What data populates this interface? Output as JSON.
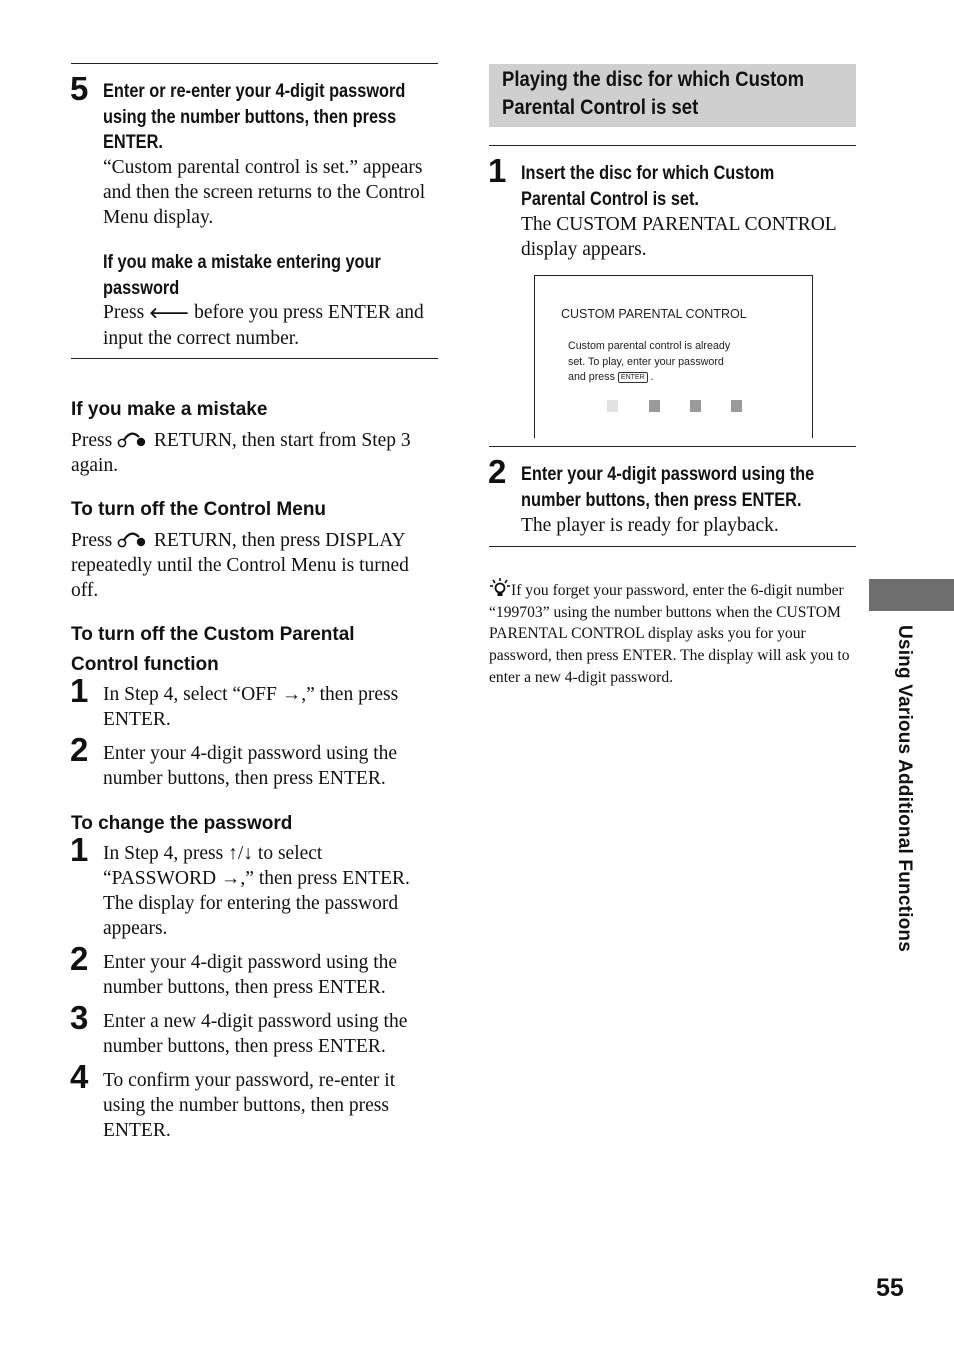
{
  "left_column": {
    "step5": {
      "number": "5",
      "heading_lines": [
        "Enter or re-enter your 4-digit password",
        "using the number buttons, then press",
        "ENTER."
      ],
      "body_lines": [
        "“Custom parental control is set.” appears",
        "and then the screen returns to the Control",
        "Menu display."
      ],
      "sub_heading_lines": [
        "If you make a mistake entering your",
        "password"
      ],
      "sub_body_prefix": "Press ",
      "sub_body_icon": "left-arrow-icon",
      "sub_body_line1_suffix": " before you press ENTER and",
      "sub_body_line2": "input the correct number."
    },
    "mistake": {
      "heading": "If you make a mistake",
      "line1_prefix": "Press ",
      "line1_suffix": " RETURN, then start from Step 3",
      "line2": "again."
    },
    "turn_off_menu": {
      "heading": "To turn off the Control Menu",
      "line1_prefix": "Press ",
      "line1_suffix": " RETURN, then press DISPLAY",
      "line2": "repeatedly until the Control Menu is turned",
      "line3": "off."
    },
    "turn_off_custom": {
      "heading_lines": [
        "To turn off the Custom Parental",
        "Control function"
      ],
      "steps": [
        {
          "number": "1",
          "lines": [
            "In Step 4, select “OFF →,” then press",
            "ENTER."
          ]
        },
        {
          "number": "2",
          "lines": [
            "Enter your 4-digit password using the",
            "number buttons, then press ENTER."
          ]
        }
      ]
    },
    "change_password": {
      "heading": "To change the password",
      "steps": [
        {
          "number": "1",
          "lines": [
            "In Step 4, press ↑/↓ to select",
            "“PASSWORD →,” then press ENTER.",
            "The display for entering the password",
            "appears."
          ]
        },
        {
          "number": "2",
          "lines": [
            "Enter your 4-digit password using the",
            "number buttons, then press ENTER."
          ]
        },
        {
          "number": "3",
          "lines": [
            "Enter a new 4-digit password using the",
            "number buttons, then press ENTER."
          ]
        },
        {
          "number": "4",
          "lines": [
            "To confirm your password, re-enter it",
            "using the number buttons, then press",
            "ENTER."
          ]
        }
      ]
    }
  },
  "right_column": {
    "section_title_lines": [
      "Playing the disc for which Custom",
      "Parental Control is set"
    ],
    "step1": {
      "number": "1",
      "heading_lines": [
        "Insert the disc for which Custom",
        "Parental Control is set."
      ],
      "body_lines": [
        "The CUSTOM PARENTAL CONTROL",
        "display appears."
      ]
    },
    "screen": {
      "title": "CUSTOM PARENTAL CONTROL",
      "message_lines": [
        "Custom parental control is already",
        "set. To play, enter your password"
      ],
      "message_line3_prefix": "and press ",
      "enter_key": "ENTER",
      "message_line3_suffix": " .",
      "password_boxes": [
        {
          "state": "active",
          "color": "#e2e2e2"
        },
        {
          "state": "empty",
          "color": "#9a9a9a"
        },
        {
          "state": "empty",
          "color": "#9a9a9a"
        },
        {
          "state": "empty",
          "color": "#9a9a9a"
        }
      ]
    },
    "step2": {
      "number": "2",
      "heading_lines": [
        "Enter your 4-digit password using the",
        "number buttons, then press ENTER."
      ],
      "body_lines": [
        "The player is ready for playback."
      ]
    },
    "tip": {
      "icon": "lightbulb-hint-icon",
      "text": "If you forget your password, enter the 6-digit number “199703” using the number buttons when the CUSTOM PARENTAL CONTROL display asks you for your password, then press ENTER. The display will ask you to enter a new 4-digit password."
    }
  },
  "side_tab": {
    "label": "Using Various Additional Functions",
    "color": "#6e6e6e"
  },
  "page_number": "55"
}
